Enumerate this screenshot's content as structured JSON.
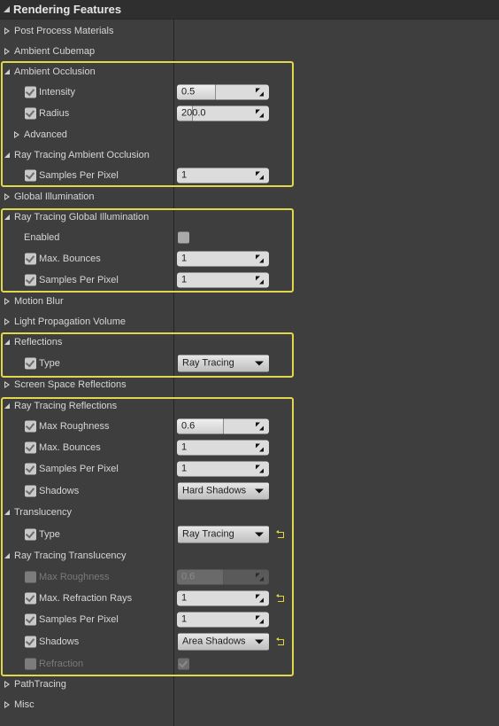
{
  "header": {
    "title": "Rendering Features"
  },
  "rows": [
    {
      "id": "post-process-materials",
      "label": "Post Process Materials",
      "kind": "category",
      "state": "collapsed"
    },
    {
      "id": "ambient-cubemap",
      "label": "Ambient Cubemap",
      "kind": "category",
      "state": "collapsed"
    },
    {
      "id": "ambient-occlusion",
      "label": "Ambient Occlusion",
      "kind": "category",
      "state": "expanded"
    },
    {
      "id": "ao-intensity",
      "label": "Intensity",
      "kind": "number",
      "override": true,
      "value": "0.5",
      "slider_fraction": 0.5
    },
    {
      "id": "ao-radius",
      "label": "Radius",
      "kind": "number",
      "override": true,
      "value": "200.0",
      "slider_fraction": 0.2
    },
    {
      "id": "ao-advanced",
      "label": "Advanced",
      "kind": "subcategory",
      "state": "collapsed"
    },
    {
      "id": "rt-ambient-occlusion",
      "label": "Ray Tracing Ambient Occlusion",
      "kind": "category",
      "state": "expanded"
    },
    {
      "id": "rtao-samples",
      "label": "Samples Per Pixel",
      "kind": "number",
      "override": true,
      "value": "1"
    },
    {
      "id": "global-illumination",
      "label": "Global Illumination",
      "kind": "category",
      "state": "collapsed"
    },
    {
      "id": "rt-global-illumination",
      "label": "Ray Tracing Global Illumination",
      "kind": "category",
      "state": "expanded"
    },
    {
      "id": "rtgi-enabled",
      "label": "Enabled",
      "kind": "bool",
      "value": false
    },
    {
      "id": "rtgi-max-bounces",
      "label": "Max. Bounces",
      "kind": "number",
      "override": true,
      "value": "1"
    },
    {
      "id": "rtgi-samples",
      "label": "Samples Per Pixel",
      "kind": "number",
      "override": true,
      "value": "1"
    },
    {
      "id": "motion-blur",
      "label": "Motion Blur",
      "kind": "category",
      "state": "collapsed"
    },
    {
      "id": "light-propagation-volume",
      "label": "Light Propagation Volume",
      "kind": "category",
      "state": "collapsed"
    },
    {
      "id": "reflections",
      "label": "Reflections",
      "kind": "category",
      "state": "expanded"
    },
    {
      "id": "reflections-type",
      "label": "Type",
      "kind": "combo",
      "override": true,
      "value": "Ray Tracing"
    },
    {
      "id": "screen-space-reflections",
      "label": "Screen Space Reflections",
      "kind": "category",
      "state": "collapsed"
    },
    {
      "id": "rt-reflections",
      "label": "Ray Tracing Reflections",
      "kind": "category",
      "state": "expanded"
    },
    {
      "id": "rtr-max-roughness",
      "label": "Max Roughness",
      "kind": "number",
      "override": true,
      "value": "0.6",
      "slider_fraction": 0.6
    },
    {
      "id": "rtr-max-bounces",
      "label": "Max. Bounces",
      "kind": "number",
      "override": true,
      "value": "1"
    },
    {
      "id": "rtr-samples",
      "label": "Samples Per Pixel",
      "kind": "number",
      "override": true,
      "value": "1"
    },
    {
      "id": "rtr-shadows",
      "label": "Shadows",
      "kind": "combo",
      "override": true,
      "value": "Hard Shadows"
    },
    {
      "id": "translucency",
      "label": "Translucency",
      "kind": "category",
      "state": "expanded"
    },
    {
      "id": "translucency-type",
      "label": "Type",
      "kind": "combo",
      "override": true,
      "value": "Ray Tracing",
      "reset": true
    },
    {
      "id": "rt-translucency",
      "label": "Ray Tracing Translucency",
      "kind": "category",
      "state": "expanded"
    },
    {
      "id": "rtt-max-roughness",
      "label": "Max Roughness",
      "kind": "number",
      "override": false,
      "disabled": true,
      "value": "0.6",
      "slider_fraction": 0.6
    },
    {
      "id": "rtt-max-refraction-rays",
      "label": "Max. Refraction Rays",
      "kind": "number",
      "override": true,
      "value": "1",
      "reset": true
    },
    {
      "id": "rtt-samples",
      "label": "Samples Per Pixel",
      "kind": "number",
      "override": true,
      "value": "1"
    },
    {
      "id": "rtt-shadows",
      "label": "Shadows",
      "kind": "combo",
      "override": true,
      "value": "Area Shadows",
      "reset": true
    },
    {
      "id": "rtt-refraction",
      "label": "Refraction",
      "kind": "bool-dim",
      "override": false,
      "disabled": true,
      "value": true
    },
    {
      "id": "path-tracing",
      "label": "PathTracing",
      "kind": "category",
      "state": "collapsed"
    },
    {
      "id": "misc",
      "label": "Misc",
      "kind": "category",
      "state": "collapsed"
    }
  ],
  "colors": {
    "highlight": "#e0d84a",
    "reset_icon": "#e2d63a"
  }
}
